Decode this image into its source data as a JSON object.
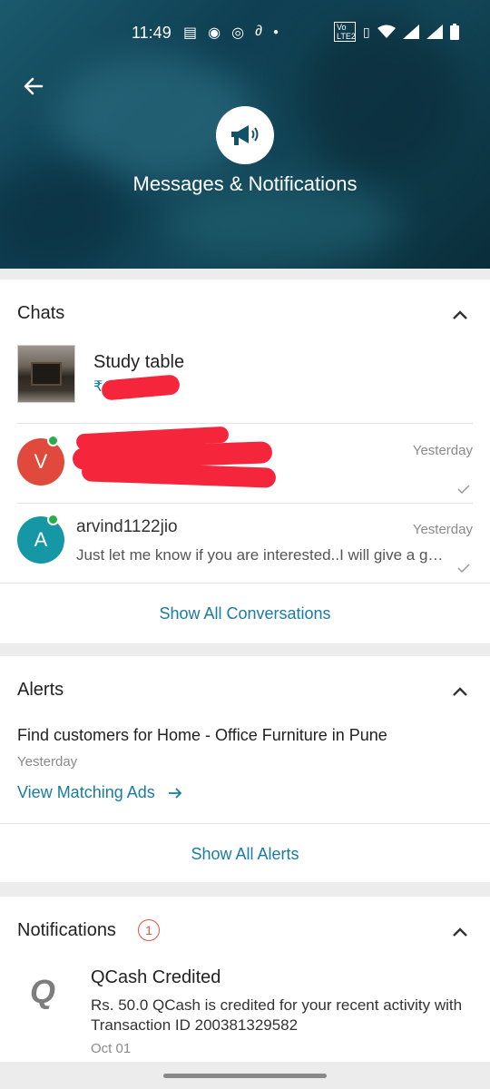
{
  "status_bar": {
    "time": "11:49",
    "volte": "Vo LTE2"
  },
  "header": {
    "title": "Messages & Notifications"
  },
  "chats": {
    "title": "Chats",
    "ad": {
      "title": "Study table",
      "price_prefix": "₹"
    },
    "conversations": [
      {
        "avatar_letter": "V",
        "avatar_color": "#e04a3c",
        "time": "Yesterday"
      },
      {
        "avatar_letter": "A",
        "avatar_color": "#1597a6",
        "name": "arvind1122jio",
        "message": "Just let me know if you are interested..I will give a good price",
        "time": "Yesterday"
      }
    ],
    "show_all": "Show All Conversations"
  },
  "alerts": {
    "title": "Alerts",
    "item_text": "Find customers for Home - Office Furniture in Pune",
    "item_time": "Yesterday",
    "link": "View Matching Ads",
    "show_all": "Show All Alerts"
  },
  "notifications": {
    "title": "Notifications",
    "badge": "1",
    "item": {
      "logo": "Q",
      "title": "QCash Credited",
      "body": "Rs. 50.0 QCash is credited for your recent activity with Transaction ID 200381329582",
      "date": "Oct 01"
    }
  },
  "colors": {
    "accent": "#1a7ba3",
    "redaction": "#f5263c",
    "online": "#27ae4a"
  }
}
